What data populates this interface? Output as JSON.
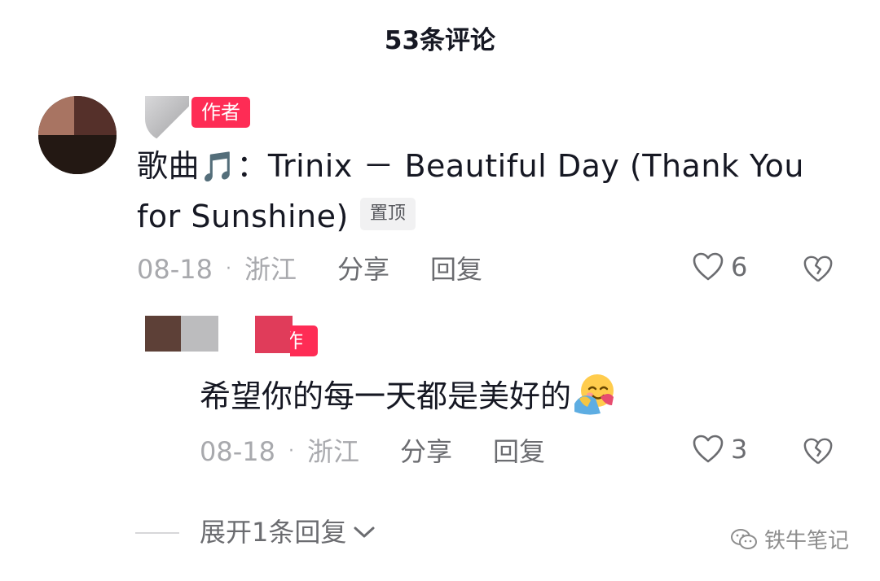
{
  "header": {
    "title": "53条评论"
  },
  "comment": {
    "author_badge": "作者",
    "text_prefix": "歌曲",
    "note_icon": "🎵",
    "text_body": "：Trinix － Beautiful Day (Thank You for Sunshine)",
    "pin_label": "置顶",
    "date": "08-18",
    "location": "浙江",
    "share_label": "分享",
    "reply_label": "回复",
    "like_count": "6"
  },
  "reply": {
    "author_badge": "作者",
    "text": "希望你的每一天都是美好的",
    "emoji_name": "hugging-face-icon",
    "date": "08-18",
    "location": "浙江",
    "share_label": "分享",
    "reply_label": "回复",
    "like_count": "3"
  },
  "expand": {
    "label": "展开1条回复"
  },
  "watermark": {
    "text": "铁牛笔记"
  },
  "colors": {
    "badge": "#fe2c55",
    "muted": "#a8a9ad",
    "action": "#6b6c70",
    "text": "#161823"
  }
}
